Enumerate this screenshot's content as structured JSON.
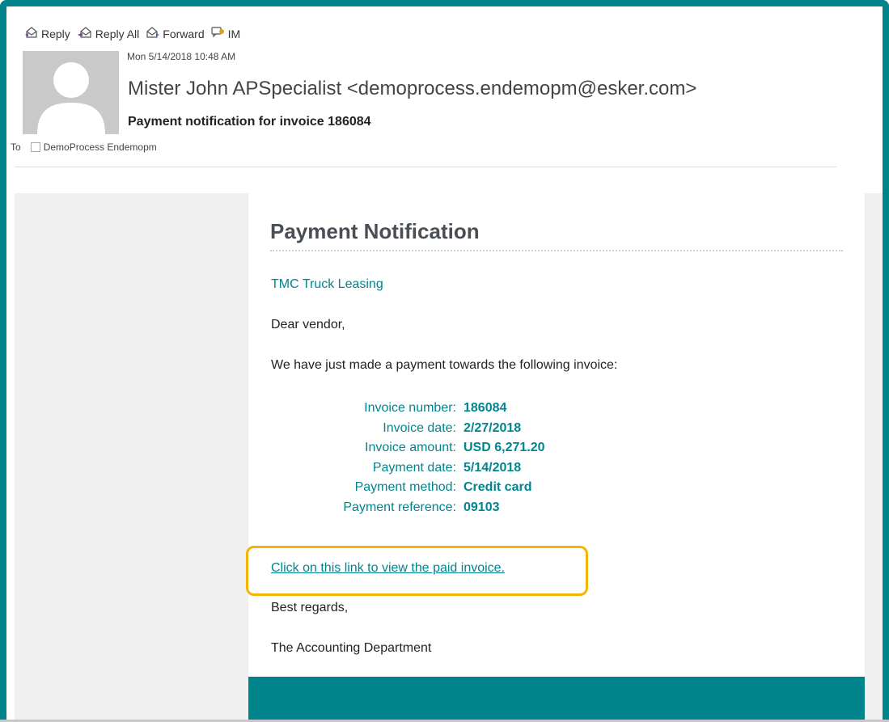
{
  "toolbar": {
    "reply": "Reply",
    "reply_all": "Reply All",
    "forward": "Forward",
    "im": "IM",
    "icons": [
      "reply-icon",
      "reply-all-icon",
      "forward-icon",
      "im-icon"
    ]
  },
  "message": {
    "date": "Mon 5/14/2018 10:48 AM",
    "sender": "Mister John APSpecialist <demoprocess.endemopm@esker.com>",
    "subject": "Payment notification for invoice 186084",
    "to_label": "To",
    "recipient": "DemoProcess Endemopm"
  },
  "body": {
    "title": "Payment Notification",
    "company": "TMC Truck Leasing",
    "salutation": "Dear vendor,",
    "intro": "We have just made a payment towards the following invoice:",
    "details": [
      {
        "label": "Invoice number:",
        "value": "186084"
      },
      {
        "label": "Invoice date:",
        "value": "2/27/2018"
      },
      {
        "label": "Invoice amount:",
        "value": "USD 6,271.20"
      },
      {
        "label": "Payment date:",
        "value": "5/14/2018"
      },
      {
        "label": "Payment method:",
        "value": "Credit card"
      },
      {
        "label": "Payment reference:",
        "value": "09103"
      }
    ],
    "link_text": "Click on this link to view the paid invoice.",
    "regards": "Best regards,",
    "signature": "The Accounting Department"
  },
  "colors": {
    "frame": "#00848c",
    "accent_text": "#00858f",
    "highlight": "#f4b400",
    "panel_gray": "#f0f0f0"
  }
}
